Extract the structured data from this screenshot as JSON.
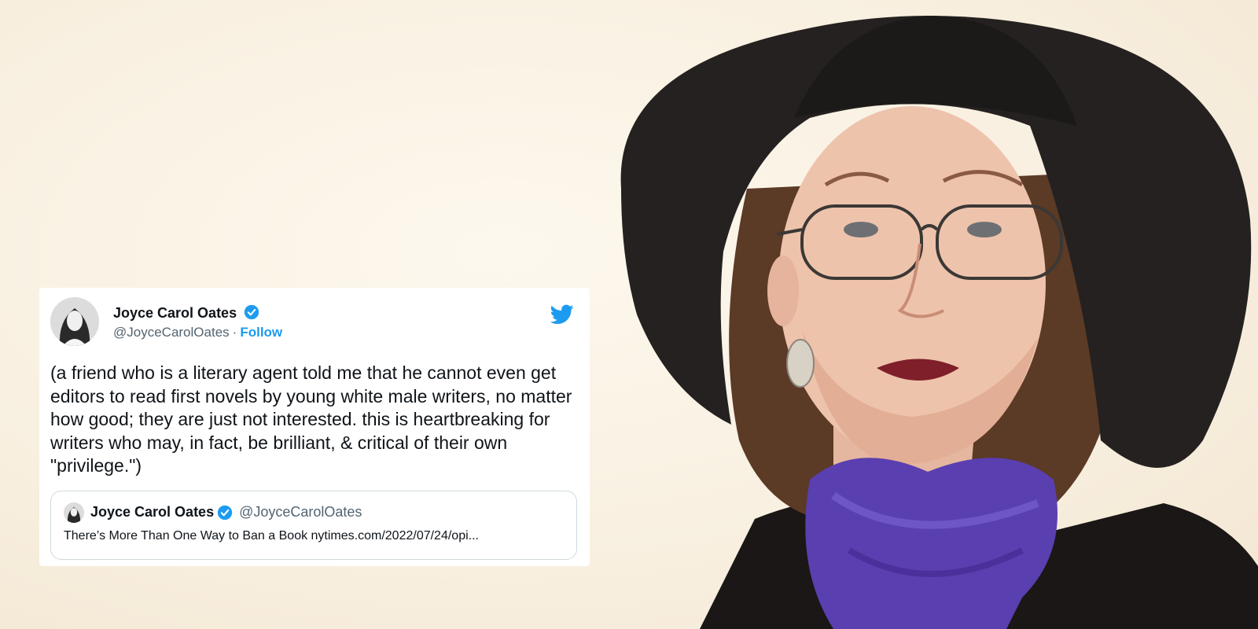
{
  "tweet": {
    "author_name": "Joyce Carol Oates",
    "handle": "@JoyceCarolOates",
    "separator": "·",
    "follow_label": "Follow",
    "text": "(a friend who is a literary agent told me that he cannot even get editors to read first novels by young white male writers, no matter how good; they are just not interested. this is heartbreaking for writers who may, in fact, be brilliant, & critical of their own \"privilege.\")",
    "quoted": {
      "author_name": "Joyce Carol Oates",
      "handle": "@JoyceCarolOates",
      "text": "There’s More Than One Way to Ban a Book nytimes.com/2022/07/24/opi..."
    }
  },
  "icons": {
    "verified": "verified-badge-icon",
    "brand": "twitter-bird-icon"
  },
  "colors": {
    "twitter_blue": "#1d9bf0",
    "text_primary": "#0f1419",
    "text_secondary": "#536471",
    "card_border": "#cfd9de",
    "scarf_purple": "#5a3fb0",
    "background": "#f8efdf"
  }
}
